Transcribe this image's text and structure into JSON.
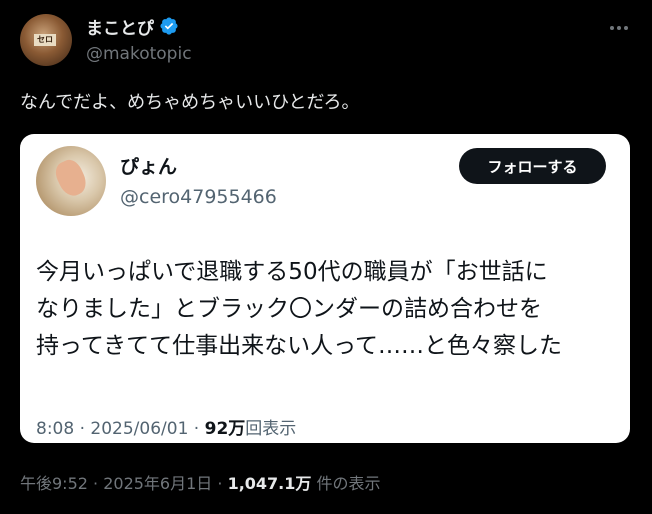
{
  "author": {
    "display_name": "まことぴ",
    "handle": "@makotopic",
    "avatar_sign": "セロ"
  },
  "tweet": {
    "text": "なんでだよ、めちゃめちゃいいひとだろ。"
  },
  "quote": {
    "display_name": "ぴょん",
    "handle": "@cero47955466",
    "follow_label": "フォローする",
    "lines": [
      "今月いっぱいで退職する50代の職員が「お世話に",
      "なりました」とブラック〇ンダーの詰め合わせを",
      "持ってきてて仕事出来ない人って……と色々察した"
    ],
    "time": "8:08",
    "date": "2025/06/01",
    "views_number": "92万",
    "views_suffix": "回表示"
  },
  "meta": {
    "time": "午後9:52",
    "date": "2025年6月1日",
    "views_number": "1,047.1万",
    "views_suffix": "件の表示"
  },
  "colors": {
    "background": "#000000",
    "verified_badge": "#1d9bf0",
    "card": "#ffffff",
    "follow_button": "#0f1419"
  }
}
